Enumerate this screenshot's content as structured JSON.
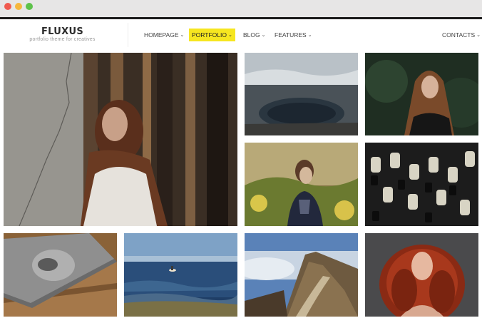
{
  "window": {
    "controls": [
      "close",
      "minimize",
      "maximize"
    ]
  },
  "brand": {
    "title": "FLUXUS",
    "tagline": "portfolio theme for creatives"
  },
  "nav": {
    "items": [
      {
        "label": "HOMEPAGE",
        "has_dropdown": true,
        "active": false
      },
      {
        "label": "PORTFOLIO",
        "has_dropdown": true,
        "active": true
      },
      {
        "label": "BLOG",
        "has_dropdown": true,
        "active": false
      },
      {
        "label": "FEATURES",
        "has_dropdown": true,
        "active": false
      }
    ],
    "contacts": {
      "label": "CONTACTS",
      "has_dropdown": true
    },
    "dropdown_glyph": "⌄",
    "active_color": "#f6e620"
  },
  "gallery": {
    "tiles": [
      {
        "subject": "woman-by-window-portrait",
        "size": "large"
      },
      {
        "subject": "geothermal-lake-landscape",
        "size": "small"
      },
      {
        "subject": "long-haired-woman-portrait",
        "size": "small"
      },
      {
        "subject": "woman-in-field-portrait",
        "size": "small"
      },
      {
        "subject": "audio-mixer-knobs",
        "size": "small"
      },
      {
        "subject": "magazine-on-wooden-table",
        "size": "small"
      },
      {
        "subject": "sea-with-surfer",
        "size": "small"
      },
      {
        "subject": "mountain-trail-above-clouds",
        "size": "small"
      },
      {
        "subject": "red-curly-hair-portrait",
        "size": "small"
      }
    ]
  }
}
